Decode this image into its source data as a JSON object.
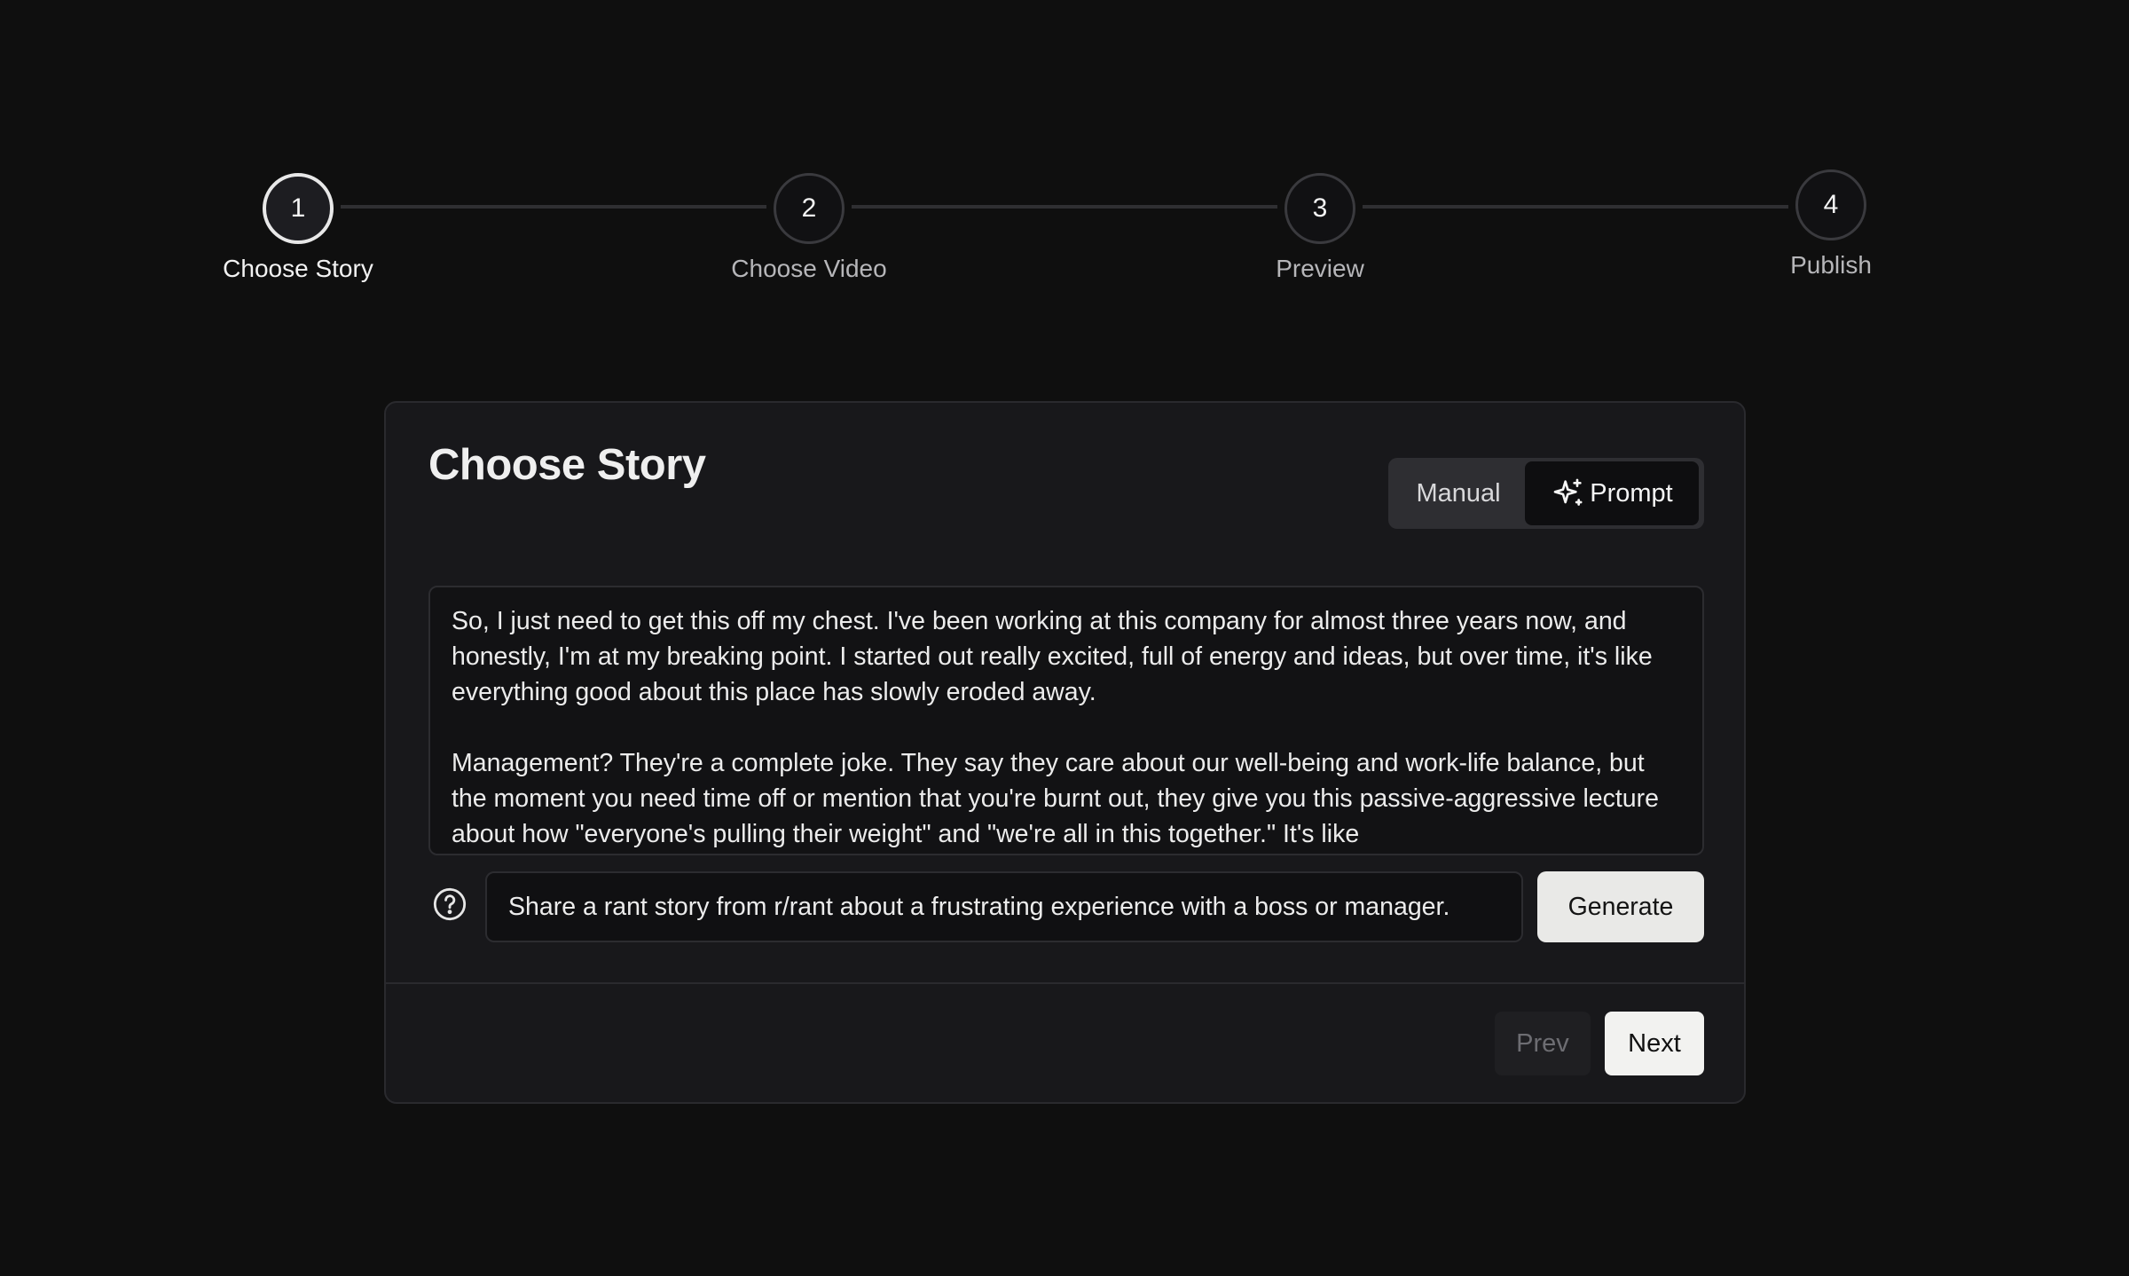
{
  "stepper": {
    "steps": [
      {
        "number": "1",
        "label": "Choose Story",
        "active": true
      },
      {
        "number": "2",
        "label": "Choose Video",
        "active": false
      },
      {
        "number": "3",
        "label": "Preview",
        "active": false
      },
      {
        "number": "4",
        "label": "Publish",
        "active": false
      }
    ]
  },
  "card": {
    "title": "Choose Story",
    "mode_toggle": {
      "manual_label": "Manual",
      "prompt_label": "Prompt",
      "selected": "Prompt"
    },
    "story_text": "So, I just need to get this off my chest. I've been working at this company for almost three years now, and honestly, I'm at my breaking point. I started out really excited, full of energy and ideas, but over time, it's like everything good about this place has slowly eroded away.\n\nManagement? They're a complete joke. They say they care about our well-being and work-life balance, but the moment you need time off or mention that you're burnt out, they give you this passive-aggressive lecture about how \"everyone's pulling their weight\" and \"we're all in this together.\" It's like",
    "prompt_input": {
      "value": "Share a rant story from r/rant about a frustrating experience with a boss or manager."
    },
    "generate_label": "Generate",
    "prev_label": "Prev",
    "next_label": "Next"
  },
  "icons": {
    "help": "question-circle-icon",
    "sparkle": "sparkle-icon"
  }
}
